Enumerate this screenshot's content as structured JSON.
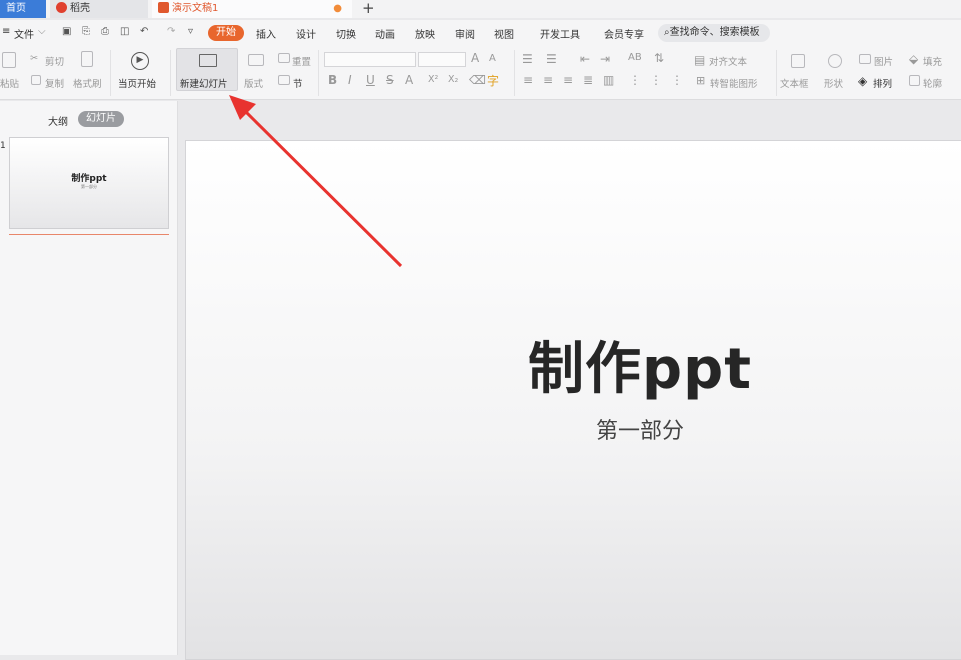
{
  "tabs": {
    "home": "首页",
    "daoke": "稻壳",
    "document": "演示文稿1",
    "unsaved_dot": "●",
    "add": "+"
  },
  "menu": {
    "file": "文件",
    "items": [
      "开始",
      "插入",
      "设计",
      "切换",
      "动画",
      "放映",
      "审阅",
      "视图",
      "开发工具",
      "会员专享"
    ],
    "search_placeholder": "查找命令、搜索模板"
  },
  "ribbon": {
    "paste": "粘贴",
    "cut": "剪切",
    "copy": "复制",
    "format_painter": "格式刷",
    "from_current": "当页开始",
    "new_slide": "新建幻灯片",
    "layout": "版式",
    "reset": "重置",
    "section": "节",
    "align_text": "对齐文本",
    "convert_smartart": "转智能图形",
    "text_box": "文本框",
    "shape": "形状",
    "picture": "图片",
    "arrange": "排列",
    "fill": "填充",
    "outline": "轮廓",
    "font_buttons": [
      "B",
      "I",
      "U",
      "S",
      "A",
      "X²",
      "X₂"
    ],
    "font_size_up": "A",
    "font_size_down": "A"
  },
  "left_panel": {
    "outline_tab": "大纲",
    "slides_tab": "幻灯片",
    "thumb_number": "1",
    "thumb_title": "制作ppt",
    "thumb_sub": "第一部分"
  },
  "slide": {
    "title": "制作ppt",
    "subtitle": "第一部分"
  },
  "colors": {
    "accent": "#e8662d",
    "home_tab": "#3b7cd8",
    "annotation_arrow": "#e8332f"
  }
}
